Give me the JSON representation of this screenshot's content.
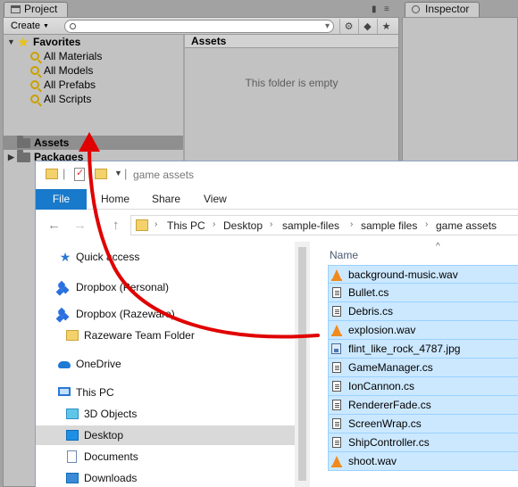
{
  "unity": {
    "project_tab": "Project",
    "inspector_tab": "Inspector",
    "create_label": "Create",
    "favorites_label": "Favorites",
    "favorites": [
      "All Materials",
      "All Models",
      "All Prefabs",
      "All Scripts"
    ],
    "assets_label": "Assets",
    "packages_label": "Packages",
    "assets_header": "Assets",
    "empty_text": "This folder is empty"
  },
  "explorer": {
    "title": "game assets",
    "ribbon": {
      "file": "File",
      "home": "Home",
      "share": "Share",
      "view": "View"
    },
    "breadcrumbs": [
      "This PC",
      "Desktop",
      "sample-files",
      "sample files",
      "game assets"
    ],
    "nav_items": [
      {
        "label": "Quick access",
        "icon": "star-icon"
      },
      {
        "label": "Dropbox (Personal)",
        "icon": "dropbox-icon"
      },
      {
        "label": "Dropbox (Razeware)",
        "icon": "dropbox-icon"
      },
      {
        "label": "Razeware Team Folder",
        "icon": "team-folder-icon"
      },
      {
        "label": "OneDrive",
        "icon": "cloud-icon"
      },
      {
        "label": "This PC",
        "icon": "pc-icon"
      },
      {
        "label": "3D Objects",
        "icon": "cube-icon"
      },
      {
        "label": "Desktop",
        "icon": "desktop-icon"
      },
      {
        "label": "Documents",
        "icon": "documents-icon"
      },
      {
        "label": "Downloads",
        "icon": "downloads-icon"
      }
    ],
    "selected_nav": "Desktop",
    "column_name": "Name",
    "files": [
      {
        "name": "background-music.wav",
        "type": "wav"
      },
      {
        "name": "Bullet.cs",
        "type": "cs"
      },
      {
        "name": "Debris.cs",
        "type": "cs"
      },
      {
        "name": "explosion.wav",
        "type": "wav"
      },
      {
        "name": "flint_like_rock_4787.jpg",
        "type": "jpg"
      },
      {
        "name": "GameManager.cs",
        "type": "cs"
      },
      {
        "name": "IonCannon.cs",
        "type": "cs"
      },
      {
        "name": "RendererFade.cs",
        "type": "cs"
      },
      {
        "name": "ScreenWrap.cs",
        "type": "cs"
      },
      {
        "name": "ShipController.cs",
        "type": "cs"
      },
      {
        "name": "shoot.wav",
        "type": "wav"
      }
    ]
  },
  "colors": {
    "drag_arrow": "#e00000",
    "explorer_selection": "#cce8ff",
    "ribbon_file": "#1979ca"
  }
}
